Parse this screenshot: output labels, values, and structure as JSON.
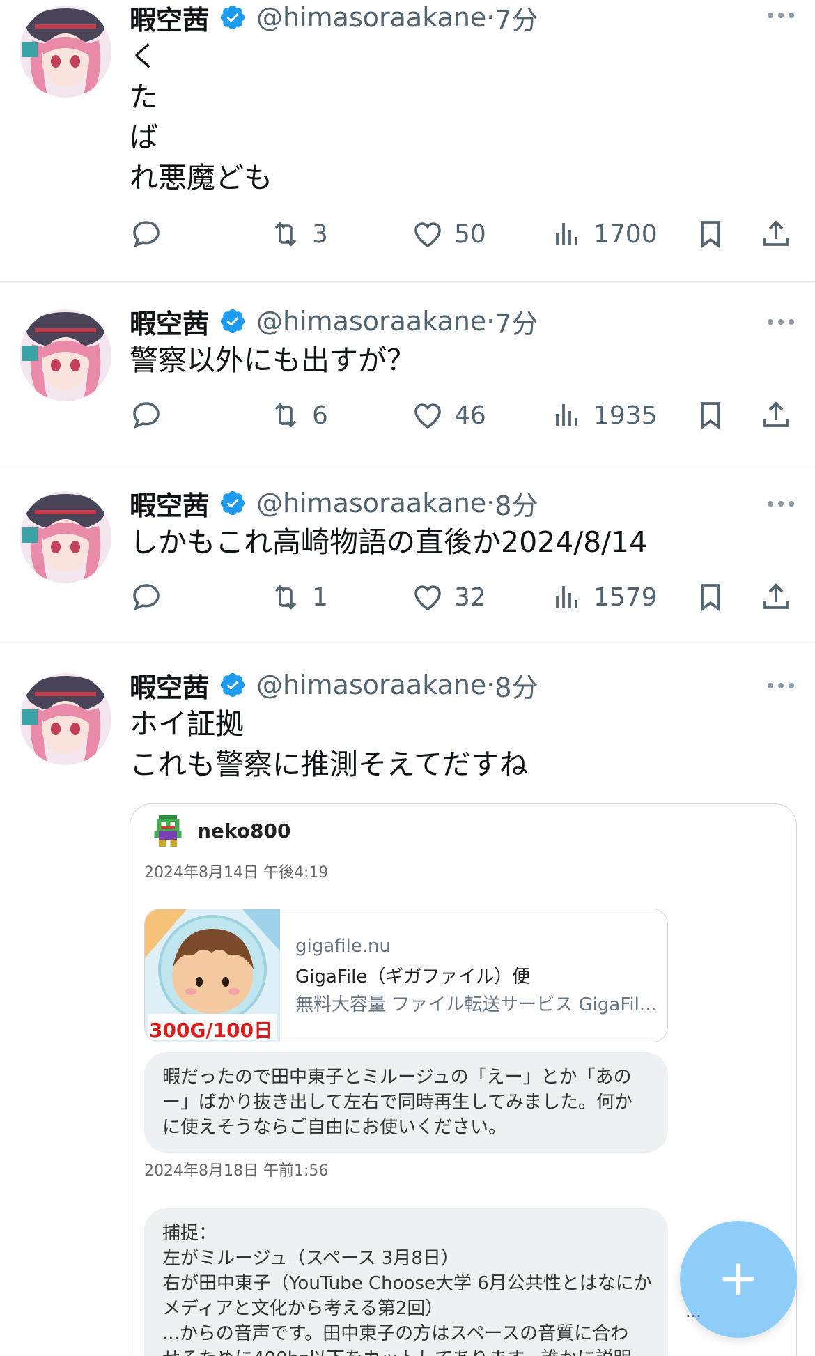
{
  "colors": {
    "verified": "#1d9bf0",
    "text": "#0f1419",
    "secondary": "#536471",
    "fab": "#8ecdf8",
    "divider": "#eff3f4"
  },
  "tweets": [
    {
      "name": "暇空茜",
      "handle": "@himasoraakane",
      "time": "7分",
      "text": "く\nた\nば\nれ悪魔ども",
      "retweets": "3",
      "likes": "50",
      "views": "1700"
    },
    {
      "name": "暇空茜",
      "handle": "@himasoraakane",
      "time": "7分",
      "text": "警察以外にも出すが？",
      "retweets": "6",
      "likes": "46",
      "views": "1935"
    },
    {
      "name": "暇空茜",
      "handle": "@himasoraakane",
      "time": "8分",
      "text": "しかもこれ高崎物語の直後か2024/8/14",
      "retweets": "1",
      "likes": "32",
      "views": "1579"
    },
    {
      "name": "暇空茜",
      "handle": "@himasoraakane",
      "time": "8分",
      "text": "ホイ証拠\nこれも警察に推測そえてだすね"
    }
  ],
  "embed": {
    "username": "neko800",
    "date1": "2024年8月14日 午後4:19",
    "link": {
      "domain": "gigafile.nu",
      "title": "GigaFile（ギガファイル）便",
      "description": "無料大容量 ファイル転送サービス GigaFil...",
      "thumb_label": "300G/100日"
    },
    "message1": [
      "暇だったので田中東子とミルージュの「えー」とか「あの",
      "ー」ばかり抜き出して左右で同時再生してみました。何か",
      "に使えそうならご自由にお使いください。"
    ],
    "date2": "2024年8月18日 午前1:56",
    "message2": [
      "捕捉：",
      "左がミルージュ（スペース 3月8日）",
      "右が田中東子（YouTube Choose大学 6月公共性とはなにか",
      "メディアと文化から考える第2回）",
      "...からの音声です。田中東子の方はスペースの音質に合わ",
      "せるために400hz以下をカットしてあります。誰かに説明"
    ]
  },
  "fab": {
    "icon": "plus-icon",
    "overflow": "..."
  }
}
